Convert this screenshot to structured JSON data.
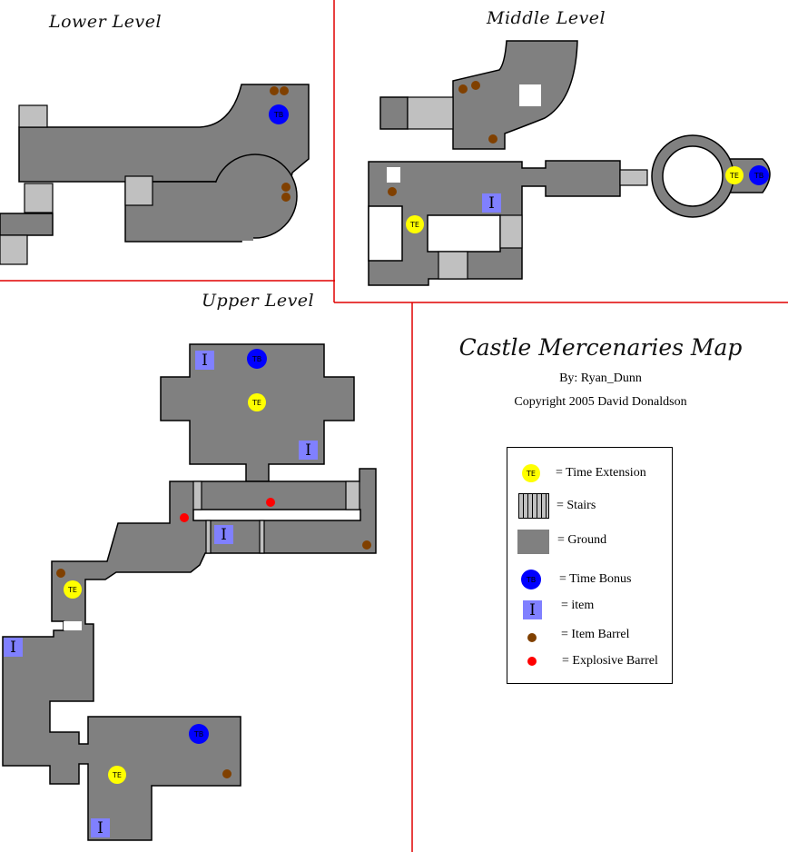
{
  "title": "Castle Mercenaries Map",
  "byline": "By: Ryan_Dunn",
  "copyright": "Copyright 2005 David Donaldson",
  "colors": {
    "ground": "#808080",
    "stairs": "#c0c0c0",
    "divider": "#e00000",
    "time_extension": "#ffff00",
    "time_bonus": "#0000ff",
    "item": "#8080ff",
    "item_barrel": "#804000",
    "explosive_barrel": "#ff0000"
  },
  "levels": {
    "lower": {
      "title": "Lower Level",
      "markers": {
        "time_bonus": 1,
        "item_barrel": 4
      }
    },
    "middle": {
      "title": "Middle Level",
      "markers": {
        "time_extension": 2,
        "time_bonus": 1,
        "item": 1,
        "item_barrel": 4
      }
    },
    "upper": {
      "title": "Upper Level",
      "markers": {
        "time_extension": 3,
        "time_bonus": 2,
        "item": 5,
        "item_barrel": 3,
        "explosive_barrel": 2
      }
    }
  },
  "marker_text": {
    "time_extension": "TE",
    "time_bonus": "TB",
    "item": "I"
  },
  "legend": {
    "items": [
      {
        "icon": "time-extension-icon",
        "symbol": "TE",
        "label": "= Time Extension"
      },
      {
        "icon": "stairs-icon",
        "symbol": "",
        "label": "= Stairs"
      },
      {
        "icon": "ground-icon",
        "symbol": "",
        "label": "= Ground"
      },
      {
        "icon": "time-bonus-icon",
        "symbol": "TB",
        "label": "= Time Bonus"
      },
      {
        "icon": "item-icon",
        "symbol": "I",
        "label": "= item"
      },
      {
        "icon": "item-barrel-icon",
        "symbol": "",
        "label": "= Item Barrel"
      },
      {
        "icon": "explosive-barrel-icon",
        "symbol": "",
        "label": "= Explosive Barrel"
      }
    ]
  }
}
